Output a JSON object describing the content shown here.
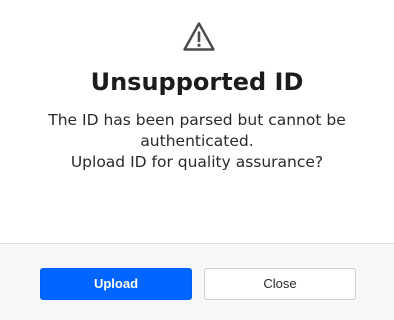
{
  "dialog": {
    "icon": "warning-triangle-icon",
    "title": "Unsupported ID",
    "message_lines": [
      "The ID has been parsed but cannot be",
      "authenticated.",
      "Upload ID for quality assurance?"
    ]
  },
  "footer": {
    "upload_label": "Upload",
    "close_label": "Close"
  },
  "colors": {
    "primary": "#0066ff",
    "footer_bg": "#f7f7f7",
    "icon": "#4a4a4a"
  }
}
